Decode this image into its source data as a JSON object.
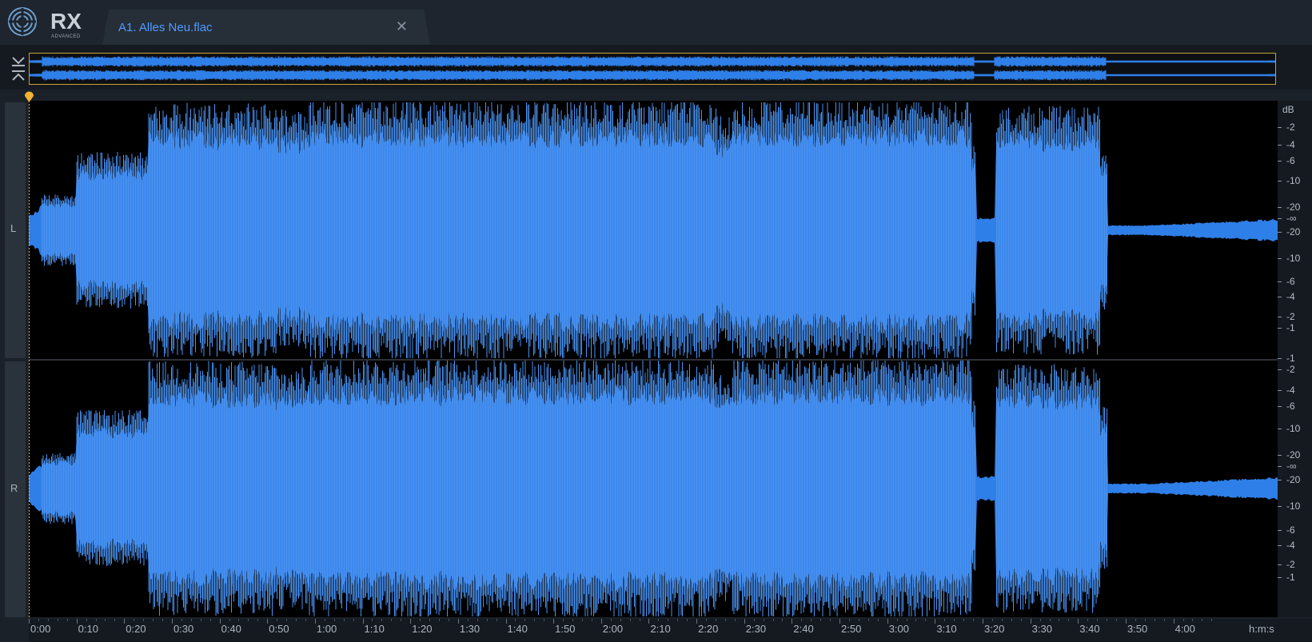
{
  "app": {
    "logo_text": "RX",
    "logo_sub": "ADVANCED"
  },
  "tabs": [
    {
      "label": "A1. Alles Neu.flac",
      "close_icon": "close-icon"
    }
  ],
  "overview": {
    "collapse_icon": "collapse-icon"
  },
  "channels": [
    {
      "label": "L"
    },
    {
      "label": "R"
    }
  ],
  "db_ruler": {
    "unit": "dB",
    "left": [
      "-2",
      "-4",
      "-6",
      "-10",
      "-20",
      "-∞",
      "-20",
      "-10",
      "-6",
      "-4",
      "-2",
      "-1"
    ],
    "right": [
      "-1",
      "-2",
      "-4",
      "-6",
      "-10",
      "-20",
      "-∞",
      "-20",
      "-10",
      "-6",
      "-4",
      "-2",
      "-1"
    ]
  },
  "timeline": {
    "ticks": [
      "0:00",
      "0:10",
      "0:20",
      "0:30",
      "0:40",
      "0:50",
      "1:00",
      "1:10",
      "1:20",
      "1:30",
      "1:40",
      "1:50",
      "2:00",
      "2:10",
      "2:20",
      "2:30",
      "2:40",
      "2:50",
      "3:00",
      "3:10",
      "3:20",
      "3:30",
      "3:40",
      "3:50",
      "4:00"
    ],
    "unit": "h:m:s"
  },
  "colors": {
    "waveform": "#2f7fe8",
    "waveform_light": "#4a92f0",
    "playhead": "#f2b233",
    "tab_text": "#4f9bff"
  }
}
